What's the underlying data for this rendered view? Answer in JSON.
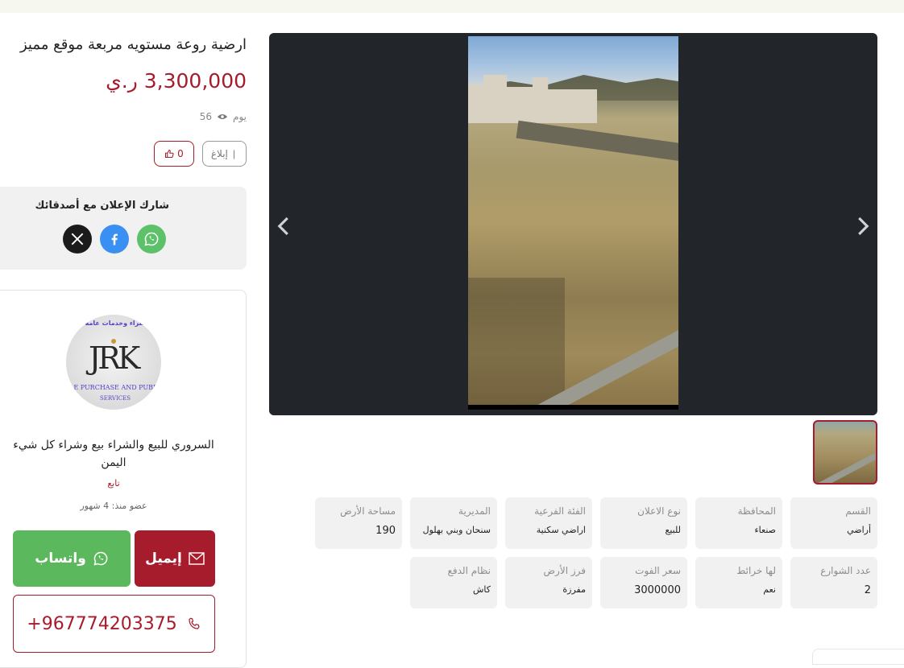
{
  "listing": {
    "title": "ارضية روعة مستويه مربعة موقع مميز",
    "price": "3,300,000 ر.ي",
    "views_count": "56",
    "views_suffix": "يوم",
    "report_label": "إبلاغ",
    "likes_count": "0"
  },
  "share": {
    "label": "شارك الإعلان مع أصدقائك",
    "icons": [
      "whatsapp-icon",
      "facebook-icon",
      "x-icon"
    ]
  },
  "seller": {
    "logo_arc_text": "بيع وشراء وخدمات عامة",
    "logo_monogram": "JRK",
    "logo_sub1": "LE PURCHASE AND PUBLI",
    "logo_sub2": "SERVICES",
    "name": "السروري للبيع والشراء بيع وشراء كل شيء اليمن",
    "role": "تابع",
    "member_since": "عضو منذ: 4 شهور",
    "email_label": "إيميل",
    "whatsapp_label": "واتساب",
    "phone": "+967774203375"
  },
  "attributes": {
    "row1": [
      {
        "key": "القسم",
        "value": "أراضي"
      },
      {
        "key": "المحافظة",
        "value": "صنعاء"
      },
      {
        "key": "نوع الاعلان",
        "value": "للبيع"
      },
      {
        "key": "الفئة الفرعية",
        "value": "اراضي سكنية"
      },
      {
        "key": "المديرية",
        "value": "سنحان وبني بهلول"
      },
      {
        "key": "مساحة الأرض",
        "value": "190"
      }
    ],
    "row2": [
      {
        "key": "عدد الشوارع",
        "value": "2"
      },
      {
        "key": "لها خرائط",
        "value": "نعم"
      },
      {
        "key": "سعر الفوت",
        "value": "3000000"
      },
      {
        "key": "فرز الأرض",
        "value": "مفرزة"
      },
      {
        "key": "نظام الدفع",
        "value": "كاش"
      }
    ]
  },
  "colors": {
    "accent": "#a61c2c",
    "whatsapp": "#5cb85c",
    "facebook": "#3a8ff2",
    "gallery_bg": "#222529",
    "card_bg": "#f1f1f1"
  }
}
